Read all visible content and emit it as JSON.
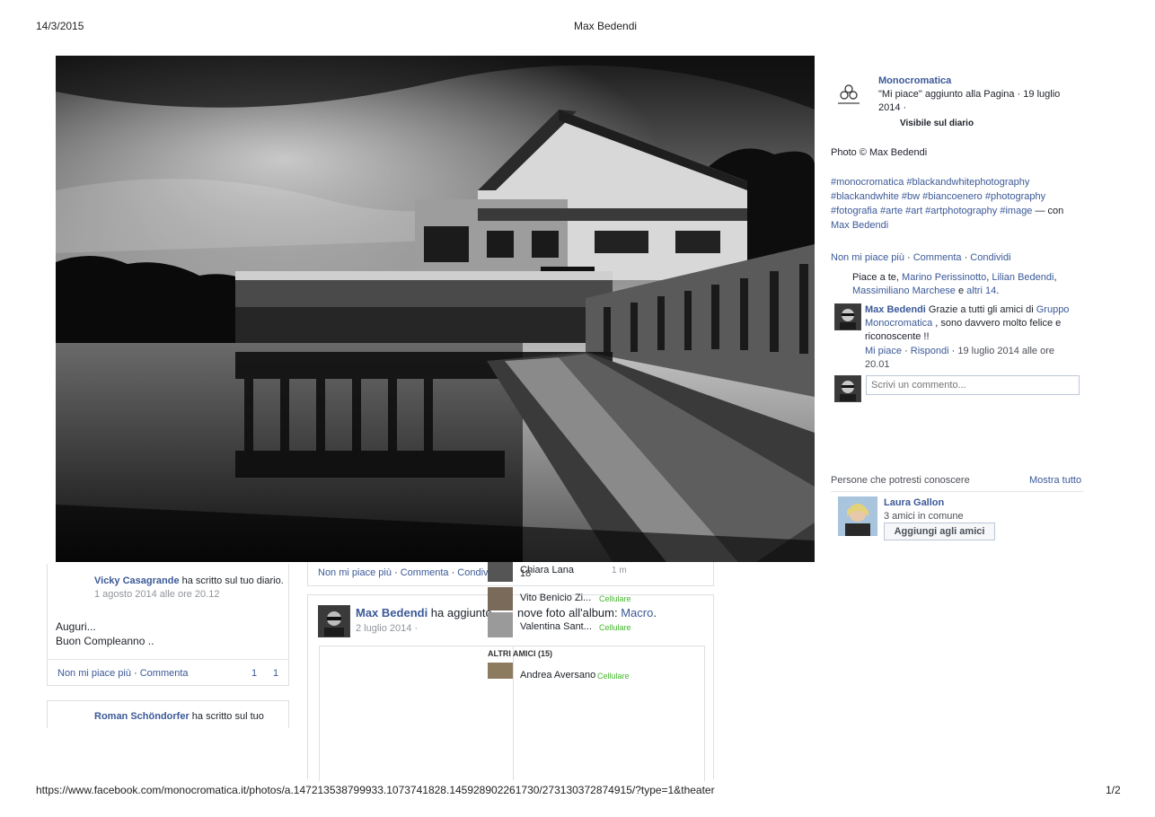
{
  "print_header": {
    "date": "14/3/2015",
    "title": "Max Bedendi"
  },
  "print_footer": {
    "url": "https://www.facebook.com/monocromatica.it/photos/a.147213538799933.1073741828.145928902261730/273130372874915/?type=1&theater",
    "page": "1/2"
  },
  "colors": {
    "link": "#3b5998",
    "border": "#dddfe2",
    "online": "#42b72a"
  },
  "photo_panel": {
    "page_name": "Monocromatica",
    "page_icon": "monocromatica-logo-icon",
    "page_logo_text": "MONOCROMATICA",
    "liked_line": "\"Mi piace\" aggiunto alla Pagina · 19 luglio",
    "liked_line2": "2014 ·",
    "visibility": "Visibile sul diario",
    "caption": "Photo © Max Bedendi",
    "hashtags_line1": "#monocromatica #blackandwhitephotography",
    "hashtags_line2": "#blackandwhite #bw #biancoenero #photography",
    "hashtags_line3": "#fotografia #arte #art #artphotography #image",
    "con_text": " — con",
    "tagged": "Max Bedendi",
    "actions": {
      "unlike": "Non mi piace più",
      "comment": "Commenta",
      "share": "Condividi"
    },
    "likes": {
      "prefix": "Piace a te, ",
      "user1": "Marino Perissinotto",
      "comma": ", ",
      "user2": "Lilian Bedendi",
      "user3": "Massimiliano Marchese",
      "and": " e ",
      "others": "altri 14",
      "dot": "."
    },
    "comment": {
      "author": "Max Bedendi",
      "text1": " Grazie a tutti gli amici di ",
      "group": "Gruppo Monocromatica",
      "text2": " , sono davvero molto felice e riconoscente !!",
      "like": "Mi piace",
      "reply": "Rispondi",
      "time": "19 luglio 2014 alle ore 20.01"
    },
    "comment_input_placeholder": "Scrivi un commento..."
  },
  "pymk": {
    "title": "Persone che potresti conoscere",
    "see_all": "Mostra tutto",
    "person": {
      "name": "Laura Gallon",
      "mutual": "3 amici in comune",
      "button": "Aggiungi agli amici"
    }
  },
  "feed": {
    "post1": {
      "author": "Vicky Casagrande",
      "action": " ha scritto sul tuo diario.",
      "time": "1 agosto 2014 alle ore 20.12",
      "line1": "Auguri...",
      "line2": "Buon Compleanno ..",
      "unlike": "Non mi piace più",
      "comment": "Commenta",
      "likes": "1",
      "comments": "1"
    },
    "post2": {
      "author": "Roman Schöndorfer",
      "action": " ha scritto sul tuo"
    },
    "post3_actions": {
      "unlike": "Non mi piace più",
      "comment": "Commenta",
      "share": "Condivi"
    },
    "post4": {
      "author": "Max Bedendi",
      "action_a": " ha aggiunto",
      "action_b": "nove foto all'album: ",
      "album": "Macro",
      "album_dot": ".",
      "time": "2 luglio 2014 ·"
    }
  },
  "chat": {
    "friends": [
      {
        "name": "Chiara Lana",
        "status": "1 m"
      },
      {
        "name": "Vito Benicio Zi...",
        "status": "Cellulare"
      },
      {
        "name": "Valentina Sant...",
        "status": "Cellulare"
      }
    ],
    "other_header": "ALTRI AMICI (15)",
    "other": [
      {
        "name": "Andrea Aversano",
        "status": "Cellulare"
      }
    ],
    "stray_number": "18"
  }
}
